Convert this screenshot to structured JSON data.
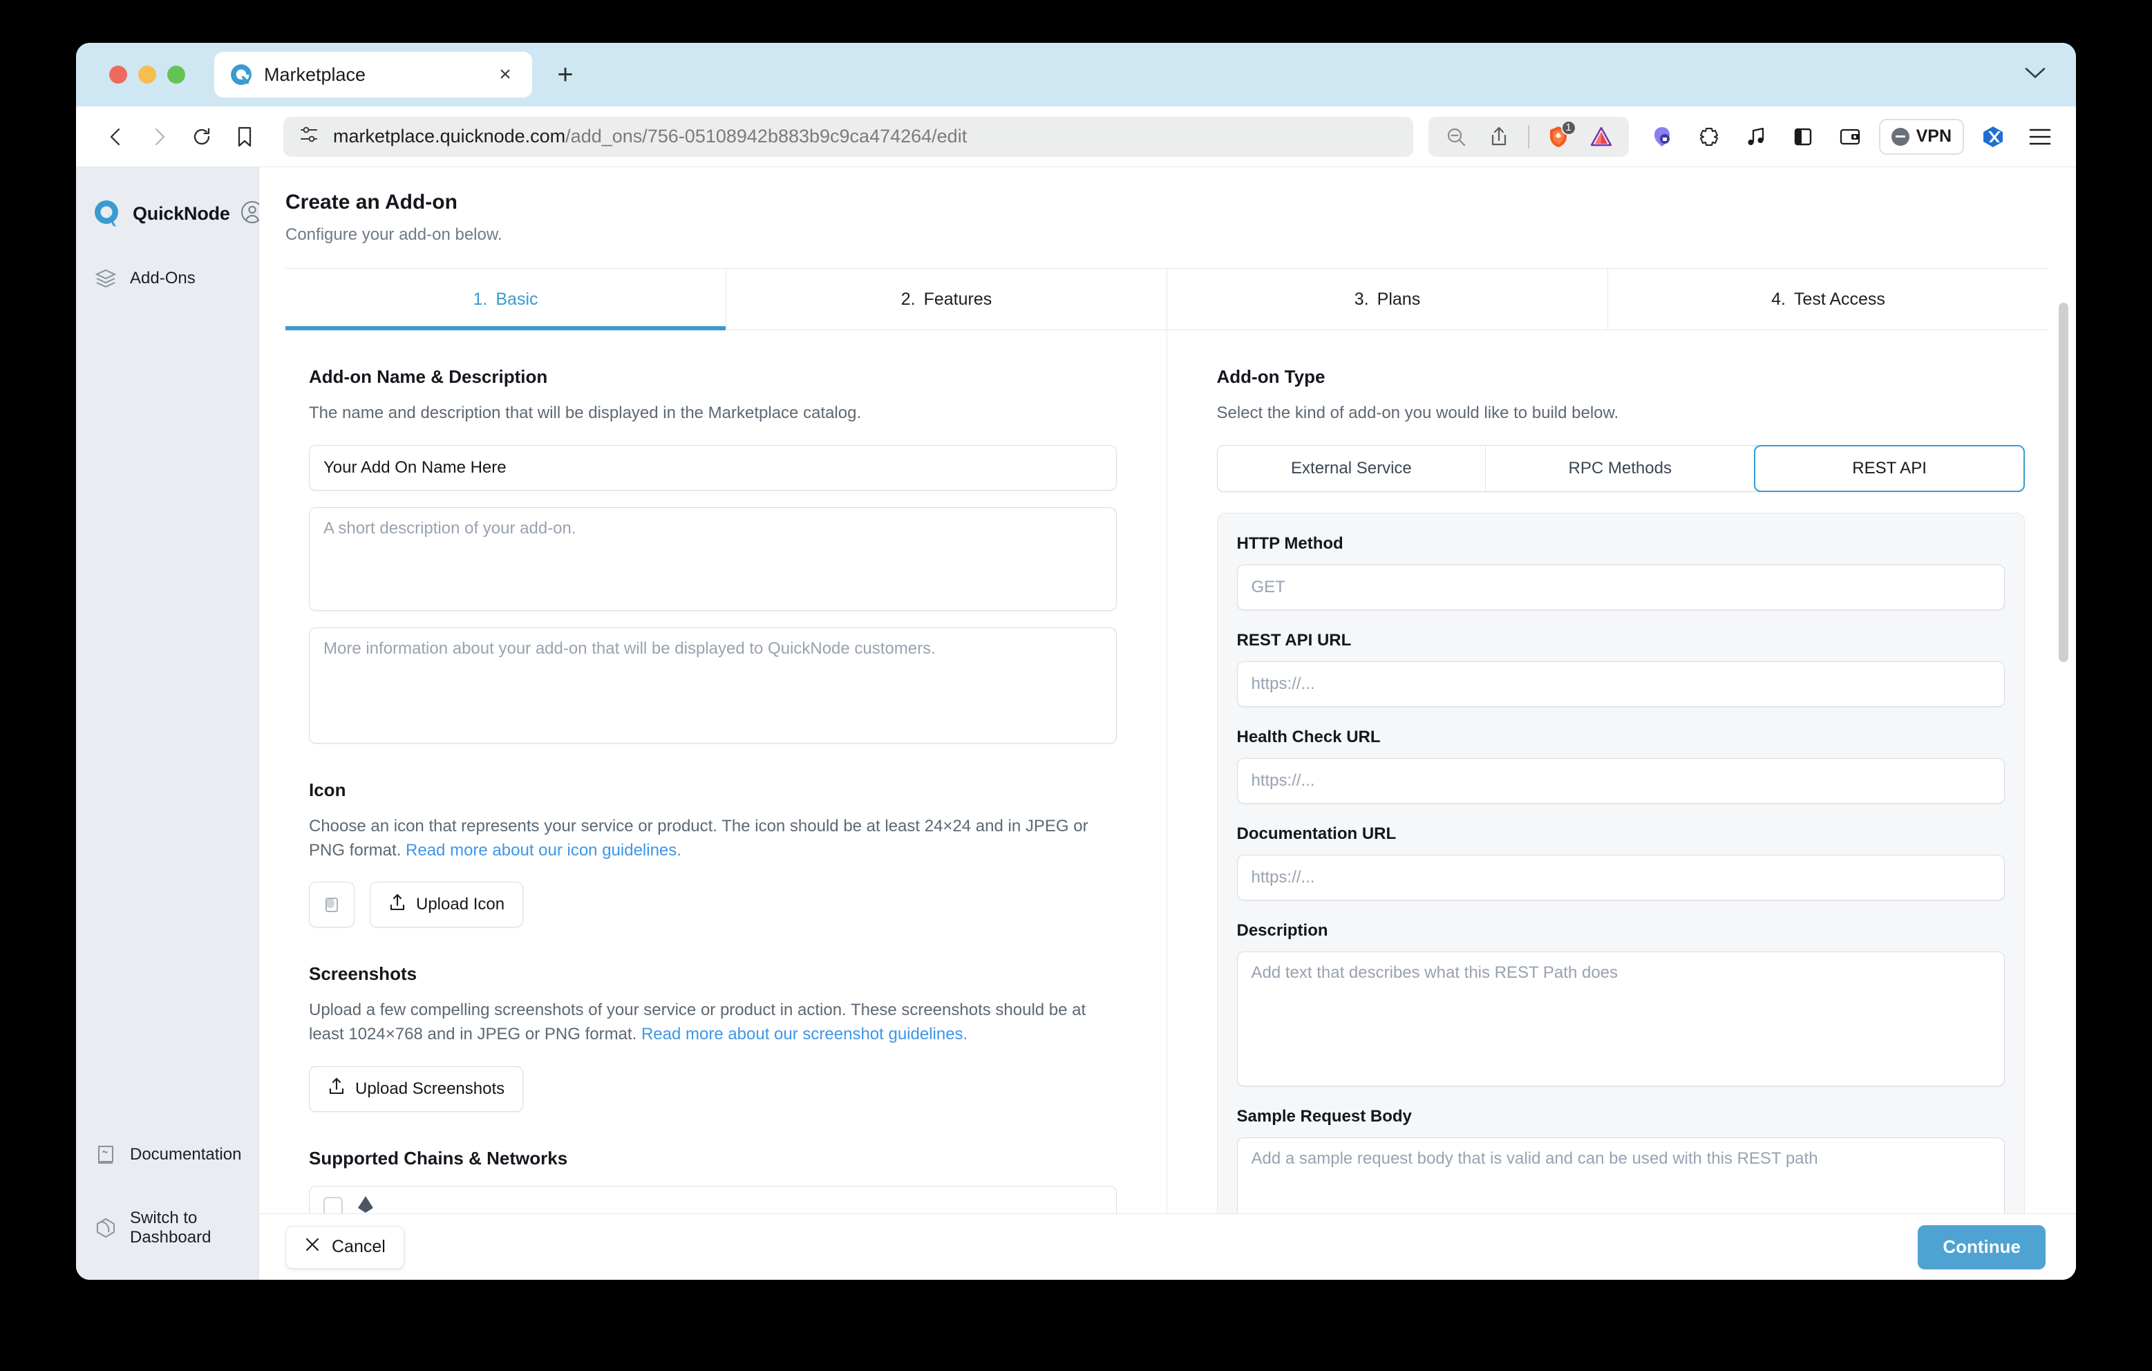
{
  "browser": {
    "tab": {
      "title": "Marketplace",
      "favicon": "quicknode-favicon",
      "close_label": "×"
    },
    "new_tab_label": "+",
    "url": {
      "domain": "marketplace.quicknode.com",
      "path": "/add_ons/756-05108942b883b9c9ca474264/edit"
    },
    "shield_badge": "1",
    "vpn_label": "VPN",
    "icons": [
      "back-icon",
      "forward-icon",
      "reload-icon",
      "bookmark-icon",
      "site-settings-icon",
      "zoom-out-icon",
      "share-icon",
      "brave-shield-icon",
      "brave-rewards-icon",
      "extension-privacy-icon",
      "extension-puzzle-icon",
      "extension-music-icon",
      "sidebar-toggle-icon",
      "wallet-icon",
      "vpn-icon",
      "extension-x-icon",
      "menu-icon"
    ]
  },
  "sidebar": {
    "brand": "QuickNode",
    "account_icon": "user-avatar-icon",
    "items": [
      {
        "label": "Add-Ons",
        "icon": "layers-icon"
      }
    ],
    "bottom_items": [
      {
        "label": "Documentation",
        "icon": "book-icon"
      },
      {
        "label": "Switch to Dashboard",
        "icon": "hexagon-icon"
      }
    ]
  },
  "header": {
    "title": "Create an Add-on",
    "subtitle": "Configure your add-on below."
  },
  "steps": [
    {
      "num": "1.",
      "label": "Basic",
      "active": true
    },
    {
      "num": "2.",
      "label": "Features",
      "active": false
    },
    {
      "num": "3.",
      "label": "Plans",
      "active": false
    },
    {
      "num": "4.",
      "label": "Test Access",
      "active": false
    }
  ],
  "left": {
    "name_section": {
      "title": "Add-on Name & Description",
      "desc": "The name and description that will be displayed in the Marketplace catalog.",
      "name_value": "Your Add On Name Here",
      "name_placeholder": "Your Add On Name Here",
      "short_desc_placeholder": "A short description of your add-on.",
      "long_desc_placeholder": "More information about your add-on that will be displayed to QuickNode customers."
    },
    "icon_section": {
      "title": "Icon",
      "desc_part1": "Choose an icon that represents your service or product. The icon should be at least 24×24 and in JPEG or PNG format. ",
      "link": "Read more about our icon guidelines.",
      "preview_icon": "image-placeholder-icon",
      "upload_label": "Upload Icon"
    },
    "screenshots_section": {
      "title": "Screenshots",
      "desc_part1": "Upload a few compelling screenshots of your service or product in action. These screenshots should be at least 1024×768 and in JPEG or PNG format. ",
      "link": "Read more about our screenshot guidelines.",
      "upload_label": "Upload Screenshots"
    },
    "chains_section": {
      "title": "Supported Chains & Networks"
    }
  },
  "right": {
    "type_section": {
      "title": "Add-on Type",
      "desc": "Select the kind of add-on you would like to build below.",
      "options": [
        "External Service",
        "RPC Methods",
        "REST API"
      ],
      "selected": "REST API"
    },
    "rest_card": {
      "http_method_label": "HTTP Method",
      "http_method_placeholder": "GET",
      "rest_url_label": "REST API URL",
      "rest_url_placeholder": "https://...",
      "health_url_label": "Health Check URL",
      "health_url_placeholder": "https://...",
      "doc_url_label": "Documentation URL",
      "doc_url_placeholder": "https://...",
      "description_label": "Description",
      "description_placeholder": "Add text that describes what this REST Path does",
      "sample_body_label": "Sample Request Body",
      "sample_body_placeholder": "Add a sample request body that is valid and can be used with this REST path"
    }
  },
  "footer": {
    "cancel_label": "Cancel",
    "continue_label": "Continue"
  },
  "colors": {
    "accent_blue": "#3a9bd1",
    "continue_blue": "#4ea3d2",
    "link_blue": "#3e96e8",
    "tabstrip": "#cfe7f3",
    "sidebar_bg": "#e9ecf0"
  }
}
